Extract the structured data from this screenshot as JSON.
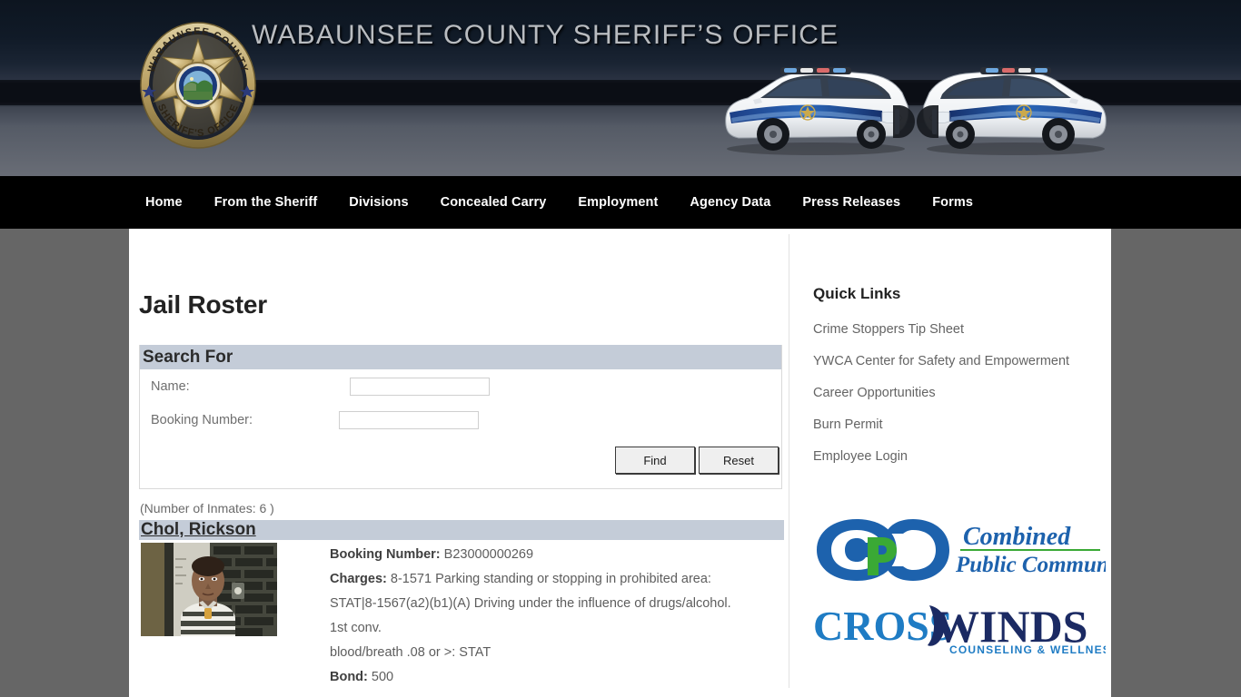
{
  "header": {
    "title": "WABAUNSEE COUNTY SHERIFF’S OFFICE",
    "badge_icon": "sheriff-badge-icon",
    "badge_top_text": "WABAUNSEE COUNTY",
    "badge_bottom_text": "SHERIFF'S OFFICE",
    "cars_icon": "police-car-icon"
  },
  "nav": {
    "items": [
      {
        "label": "Home"
      },
      {
        "label": "From the Sheriff"
      },
      {
        "label": "Divisions"
      },
      {
        "label": "Concealed Carry"
      },
      {
        "label": "Employment"
      },
      {
        "label": "Agency Data"
      },
      {
        "label": "Press Releases"
      },
      {
        "label": "Forms"
      }
    ]
  },
  "main": {
    "page_title": "Jail Roster",
    "search": {
      "panel_title": "Search For",
      "name_label": "Name:",
      "name_value": "",
      "name_placeholder": "",
      "booking_label": "Booking Number:",
      "booking_value": "",
      "booking_placeholder": "",
      "find_label": "Find",
      "reset_label": "Reset"
    },
    "inmate_count_text": "(Number of Inmates: 6 )",
    "inmates": [
      {
        "name": "Chol, Rickson",
        "mugshot_alt": "inmate-mugshot",
        "booking_label": "Booking Number:",
        "booking_number": "B23000000269",
        "charges_label": "Charges:",
        "charges_line1": "8-1571 Parking standing or stopping in prohibited area:",
        "charges_line2": "STAT|8-1567(a2)(b1)(A) Driving under the influence of drugs/alcohol.",
        "charges_line3": "1st conv.",
        "charges_line4": "blood/breath .08 or >: STAT",
        "bond_label": "Bond:",
        "bond_value": "500"
      }
    ]
  },
  "sidebar": {
    "quick_links_title": "Quick Links",
    "links": [
      {
        "label": "Crime Stoppers Tip Sheet"
      },
      {
        "label": "YWCA Center for Safety and Empowerment"
      },
      {
        "label": "Career Opportunities"
      },
      {
        "label": "Burn Permit"
      },
      {
        "label": "Employee Login"
      }
    ],
    "sponsors": [
      {
        "name": "combined-public-communications-logo",
        "line1": "Combined",
        "line2": "Public Communications",
        "mark": "CPC"
      },
      {
        "name": "crosswinds-logo",
        "line1": "CROSSWINDS",
        "line2": "COUNSELING & WELLNESS"
      }
    ]
  },
  "colors": {
    "nav_background": "#000000",
    "page_background": "#666666",
    "panel_header": "#c4ccd8",
    "text_muted": "#646464",
    "cpc_blue": "#1d62ad",
    "cpc_green": "#3aa935",
    "crosswinds_blue": "#1f7cc4",
    "crosswinds_navy": "#1b2a63"
  }
}
